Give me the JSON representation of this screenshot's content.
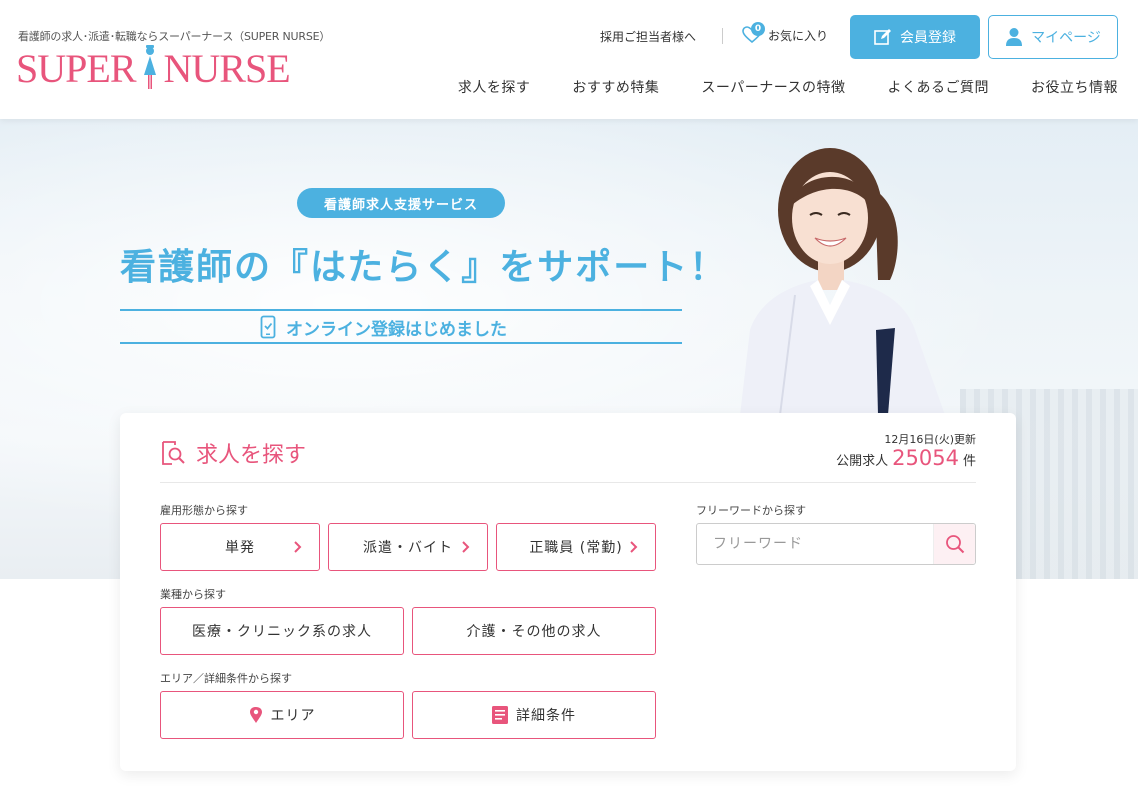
{
  "header": {
    "tagline": "看護師の求人･派遣･転職ならスーパーナース（SUPER NURSE）",
    "logo_left": "SUPER",
    "logo_right": "NURSE",
    "recruit_link": "採用ご担当者様へ",
    "favorites_label": "お気に入り",
    "favorites_count": "0",
    "register_button": "会員登録",
    "mypage_button": "マイページ",
    "nav": [
      "求人を探す",
      "おすすめ特集",
      "スーパーナースの特徴",
      "よくあるご質問",
      "お役立ち情報"
    ]
  },
  "hero": {
    "pill": "看護師求人支援サービス",
    "headline": "看護師の『はたらく』をサポート！",
    "subcopy": "オンライン登録はじめました"
  },
  "search": {
    "title": "求人を探す",
    "updated": "12月16日(火)更新",
    "count_prefix": "公開求人",
    "count": "25054",
    "count_suffix": "件",
    "employment_label": "雇用形態から探す",
    "employment_options": [
      "単発",
      "派遣・バイト",
      "正職員 (常勤)"
    ],
    "industry_label": "業種から探す",
    "industry_options": [
      "医療・クリニック系の求人",
      "介護・その他の求人"
    ],
    "area_label": "エリア／詳細条件から探す",
    "area_options": [
      "エリア",
      "詳細条件"
    ],
    "freeword_label": "フリーワードから探す",
    "freeword_placeholder": "フリーワード"
  },
  "colors": {
    "brand_pink": "#e8557c",
    "brand_blue": "#4cb1e0"
  },
  "icons": [
    "logo-nurse-mark",
    "heart-icon",
    "pencil-square-icon",
    "user-icon",
    "smartphone-icon",
    "document-search-icon",
    "chevron-right-icon",
    "map-pin-icon",
    "list-document-icon",
    "search-icon"
  ]
}
